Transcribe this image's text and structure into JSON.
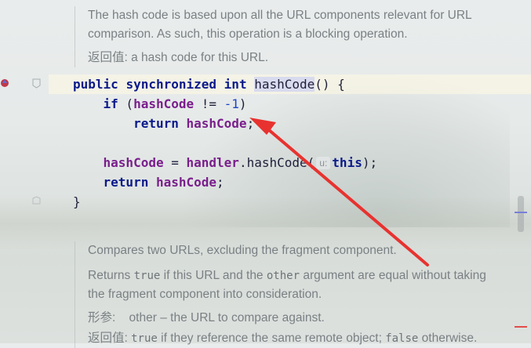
{
  "colors": {
    "keyword": "#0b1a8a",
    "field": "#7a1f8c",
    "number": "#1c42c8",
    "doc_text": "#7a8084",
    "arrow": "#e8322f"
  },
  "doc_top": {
    "line1": "The hash code is based upon all the URL components relevant for URL",
    "line2": "comparison. As such, this operation is a blocking operation.",
    "returns_label": "返回值:",
    "returns_text": "a hash code for this URL."
  },
  "code": {
    "line1": {
      "kw1": "public",
      "kw2": "synchronized",
      "kw3": "int",
      "method": "hashCode",
      "rest": "() {"
    },
    "line2": {
      "kw": "if",
      "open": " (",
      "field": "hashCode",
      "op": " != ",
      "num": "-1",
      "close": ")"
    },
    "line3": {
      "kw": "return",
      "field": "hashCode",
      "end": ";"
    },
    "line4": {
      "field": "hashCode",
      "op": " = ",
      "field2": "handler",
      "dot": ".",
      "method": "hashCode",
      "paren": "(",
      "hint": "u:",
      "kw": "this",
      "end": ");"
    },
    "line5": {
      "kw": "return",
      "field": "hashCode",
      "end": ";"
    },
    "line6": "}"
  },
  "doc_bottom": {
    "line1": "Compares two URLs, excluding the fragment component.",
    "line2a": "Returns ",
    "line2_code1": "true",
    "line2b": " if this URL and the ",
    "line2_code2": "other",
    "line2c": " argument are equal without taking",
    "line3": "the fragment component into consideration.",
    "params_label": "形参:",
    "params_name": "other",
    "params_dash": "–",
    "params_text": "the URL to compare against.",
    "returns_label": "返回值:",
    "returns_code1": "true",
    "returns_text": " if they reference the same remote object; ",
    "returns_code2": "false",
    "returns_text2": " otherwise."
  },
  "icons": [
    "override-method-icon",
    "bookmark-fold-icon",
    "fold-end-icon"
  ]
}
